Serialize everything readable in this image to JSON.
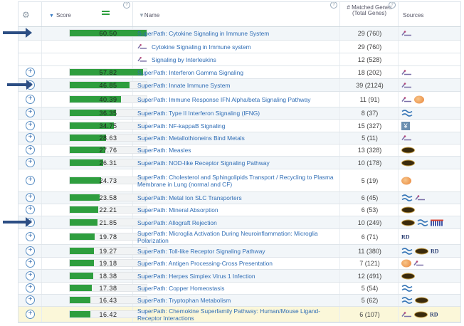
{
  "header": {
    "score_label": "Score",
    "name_label": "Name",
    "genes_label": "# Matched Genes (Total Genes)",
    "sources_label": "Sources",
    "info_glyph": "?"
  },
  "colors": {
    "bar": "#2e9e3e",
    "link": "#2f6db5",
    "highlight": "#fbf7d9"
  },
  "max_score": 60.5,
  "rows": [
    {
      "type": "parent",
      "expandable": false,
      "score": "60.50",
      "name": "SuperPath: Cytokine Signaling in Immune System",
      "genes": "29 (760)",
      "sources": [
        "superpath"
      ],
      "h": 19
    },
    {
      "type": "child",
      "name": "Cytokine Signaling in Immune system",
      "genes": "29 (760)",
      "sources": [],
      "h": 18
    },
    {
      "type": "child",
      "name": "Signaling by Interleukins",
      "genes": "12 (528)",
      "sources": [],
      "h": 18
    },
    {
      "type": "parent",
      "expandable": true,
      "score": "57.82",
      "name": "SuperPath: Interferon Gamma Signaling",
      "genes": "18 (202)",
      "sources": [
        "superpath"
      ],
      "h": 18
    },
    {
      "type": "parent",
      "expandable": true,
      "score": "46.85",
      "name": "SuperPath: Innate Immune System",
      "genes": "39 (2124)",
      "sources": [
        "superpath"
      ],
      "h": 18
    },
    {
      "type": "parent",
      "expandable": true,
      "score": "40.39",
      "name": "SuperPath: Immune Response IFN Alpha/beta Signaling Pathway",
      "genes": "11 (91)",
      "sources": [
        "superpath",
        "orange"
      ],
      "h": 22
    },
    {
      "type": "parent",
      "expandable": true,
      "score": "36.35",
      "name": "SuperPath: Type II Interferon Signaling (IFNG)",
      "genes": "8 (37)",
      "sources": [
        "coil"
      ],
      "h": 17
    },
    {
      "type": "parent",
      "expandable": true,
      "score": "34.75",
      "name": "SuperPath: NF-kappaB Signaling",
      "genes": "15 (327)",
      "sources": [
        "tree"
      ],
      "h": 18
    },
    {
      "type": "parent",
      "expandable": true,
      "score": "28.63",
      "name": "SuperPath: Metallothioneins Bind Metals",
      "genes": "5 (11)",
      "sources": [
        "superpath"
      ],
      "h": 17
    },
    {
      "type": "parent",
      "expandable": true,
      "score": "27.76",
      "name": "SuperPath: Measles",
      "genes": "13 (328)",
      "sources": [
        "kegg"
      ],
      "h": 17
    },
    {
      "type": "parent",
      "expandable": true,
      "score": "26.31",
      "name": "SuperPath: NOD-like Receptor Signaling Pathway",
      "genes": "10 (178)",
      "sources": [
        "kegg"
      ],
      "h": 18
    },
    {
      "type": "parent",
      "expandable": true,
      "score": "24.73",
      "name": "SuperPath: Cholesterol and Sphingolipids Transport / Recycling to Plasma Membrane in Lung (normal and CF)",
      "genes": "5 (19)",
      "sources": [
        "orange"
      ],
      "h": 32
    },
    {
      "type": "parent",
      "expandable": true,
      "score": "23.58",
      "name": "SuperPath: Metal Ion SLC Transporters",
      "genes": "6 (45)",
      "sources": [
        "coil",
        "superpath"
      ],
      "h": 17
    },
    {
      "type": "parent",
      "expandable": true,
      "score": "22.21",
      "name": "SuperPath: Mineral Absorption",
      "genes": "6 (53)",
      "sources": [
        "kegg"
      ],
      "h": 17
    },
    {
      "type": "parent",
      "expandable": true,
      "score": "21.85",
      "name": "SuperPath: Allograft Rejection",
      "genes": "10 (249)",
      "sources": [
        "kegg",
        "coil",
        "grid"
      ],
      "h": 18
    },
    {
      "type": "parent",
      "expandable": true,
      "score": "19.78",
      "name": "SuperPath: Microglia Activation During Neuroinflammation: Microglia Polarization",
      "genes": "6 (71)",
      "sources": [
        "rd"
      ],
      "h": 22
    },
    {
      "type": "parent",
      "expandable": true,
      "score": "19.27",
      "name": "SuperPath: Toll-like Receptor Signaling Pathway",
      "genes": "11 (380)",
      "sources": [
        "coil",
        "kegg",
        "rd"
      ],
      "h": 18
    },
    {
      "type": "parent",
      "expandable": true,
      "score": "19.18",
      "name": "SuperPath: Antigen Processing-Cross Presentation",
      "genes": "7 (121)",
      "sources": [
        "orange",
        "superpath"
      ],
      "h": 17
    },
    {
      "type": "parent",
      "expandable": true,
      "score": "18.38",
      "name": "SuperPath: Herpes Simplex Virus 1 Infection",
      "genes": "12 (491)",
      "sources": [
        "kegg"
      ],
      "h": 18
    },
    {
      "type": "parent",
      "expandable": true,
      "score": "17.38",
      "name": "SuperPath: Copper Homeostasis",
      "genes": "5 (54)",
      "sources": [
        "coil"
      ],
      "h": 17
    },
    {
      "type": "parent",
      "expandable": true,
      "score": "16.43",
      "name": "SuperPath: Tryptophan Metabolism",
      "genes": "5 (62)",
      "sources": [
        "coil",
        "kegg"
      ],
      "h": 17
    },
    {
      "type": "parent",
      "expandable": true,
      "score": "16.42",
      "name": "SuperPath: Chemokine Superfamily Pathway: Human/Mouse Ligand-Receptor Interactions",
      "genes": "6 (107)",
      "sources": [
        "superpath",
        "kegg",
        "rd"
      ],
      "h": 22,
      "highlight": true
    }
  ]
}
